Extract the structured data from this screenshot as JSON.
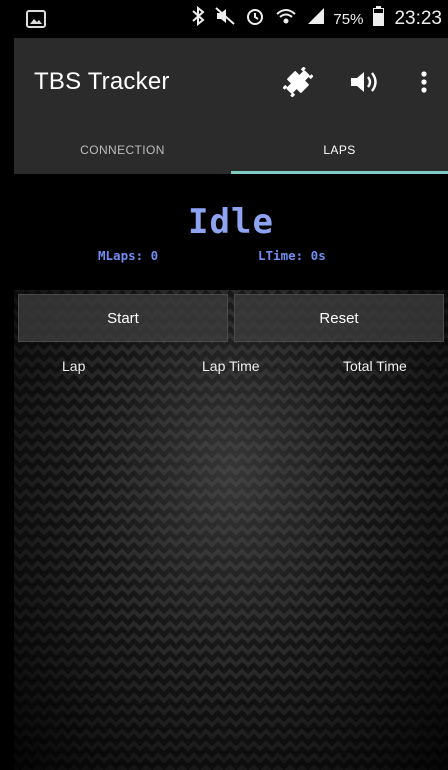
{
  "status_bar": {
    "battery_percent": "75%",
    "time": "23:23",
    "icons": [
      "gallery-icon",
      "bluetooth-icon",
      "mute-icon",
      "alarm-icon",
      "wifi-icon",
      "signal-icon",
      "battery-icon"
    ]
  },
  "app_bar": {
    "title": "TBS Tracker",
    "actions": [
      "bluetooth-disconnect-icon",
      "speaker-icon",
      "overflow-menu-icon"
    ]
  },
  "tabs": [
    {
      "label": "CONNECTION",
      "active": false
    },
    {
      "label": "LAPS",
      "active": true
    }
  ],
  "hud": {
    "state": "Idle",
    "mlaps": "MLaps: 0",
    "ltime": "LTime: 0s"
  },
  "buttons": {
    "start": "Start",
    "reset": "Reset"
  },
  "table": {
    "columns": [
      "Lap",
      "Lap Time",
      "Total Time"
    ]
  },
  "colors": {
    "accent": "#80cbc4",
    "hud_text": "#8ea4f2",
    "appbar": "#2b2b2b"
  }
}
